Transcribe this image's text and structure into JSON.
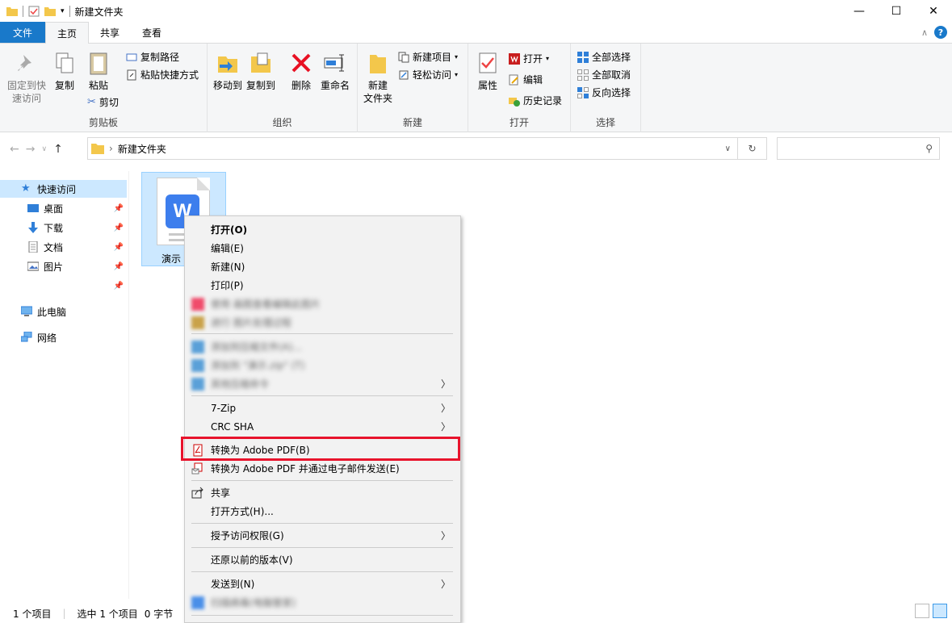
{
  "window": {
    "title": "新建文件夹"
  },
  "ribbon_tabs": [
    "文件",
    "主页",
    "共享",
    "查看"
  ],
  "ribbon": {
    "clipboard": {
      "label": "剪贴板",
      "pin": "固定到快\n速访问",
      "copy": "复制",
      "paste": "粘贴",
      "copy_path": "复制路径",
      "paste_shortcut": "粘贴快捷方式",
      "cut": "剪切"
    },
    "organize": {
      "label": "组织",
      "move_to": "移动到",
      "copy_to": "复制到",
      "delete": "删除",
      "rename": "重命名"
    },
    "new": {
      "label": "新建",
      "new_folder": "新建\n文件夹",
      "new_item": "新建项目",
      "easy_access": "轻松访问"
    },
    "open": {
      "label": "打开",
      "properties": "属性",
      "open": "打开",
      "edit": "编辑",
      "history": "历史记录"
    },
    "select": {
      "label": "选择",
      "select_all": "全部选择",
      "select_none": "全部取消",
      "invert": "反向选择"
    }
  },
  "address": {
    "path": "新建文件夹"
  },
  "sidebar": {
    "quick_access": "快速访问",
    "items": [
      "桌面",
      "下载",
      "文档",
      "图片"
    ],
    "this_pc": "此电脑",
    "network": "网络"
  },
  "file": {
    "name": "演示"
  },
  "status": {
    "count": "1 个项目",
    "selected": "选中 1 个项目",
    "size": "0 字节"
  },
  "context_menu": {
    "open": "打开(O)",
    "edit": "编辑(E)",
    "new": "新建(N)",
    "print": "打印(P)",
    "blur1": "使用 画图查看编辑此图片",
    "blur2": "进行 图片处理过程",
    "blur3": "添加到压缩文件(A)...",
    "blur4": "添加到 \"演示.zip\" (T)",
    "blur5": "其他压缩命令",
    "zip7": "7-Zip",
    "crc": "CRC SHA",
    "to_pdf": "转换为 Adobe PDF(B)",
    "to_pdf_email": "转换为 Adobe PDF 并通过电子邮件发送(E)",
    "share": "共享",
    "open_with": "打开方式(H)...",
    "grant_access": "授予访问权限(G)",
    "restore": "还原以前的版本(V)",
    "send_to": "发送到(N)",
    "blur6": "扫描病毒(电脑管家)"
  },
  "colors": {
    "accent": "#1979ca",
    "selection": "#cce8ff",
    "highlight_border": "#e8132c"
  }
}
